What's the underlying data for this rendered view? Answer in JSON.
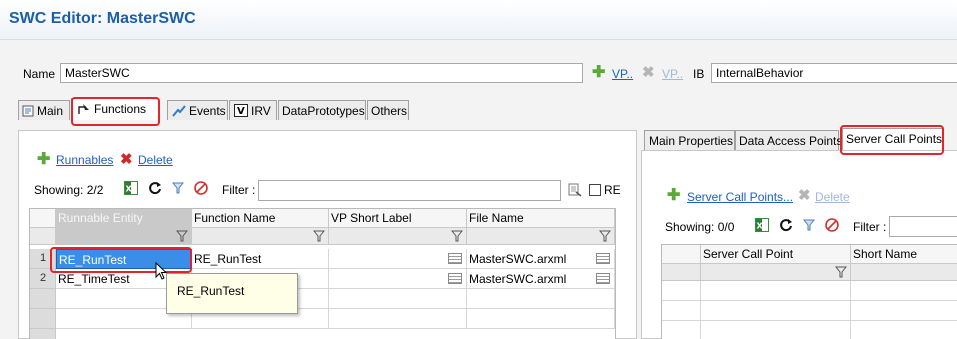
{
  "editor": {
    "title": "SWC Editor: MasterSWC"
  },
  "header": {
    "name_label": "Name",
    "name_value": "MasterSWC",
    "vp_link": "VP..",
    "vp_link_disabled": "VP..",
    "ib_label": "IB",
    "ib_value": "InternalBehavior"
  },
  "tabs": [
    {
      "label": "Main"
    },
    {
      "label": "Functions",
      "active": true
    },
    {
      "label": "Events"
    },
    {
      "label": "IRV"
    },
    {
      "label": "DataPrototypes"
    },
    {
      "label": "Others"
    }
  ],
  "left": {
    "add_link": "Runnables",
    "delete_link": "Delete",
    "showing": "Showing: 2/2",
    "filter_label": "Filter :",
    "filter_value": "",
    "re_label": "RE",
    "columns": [
      "Runnable Entity",
      "Function Name",
      "VP Short Label",
      "File Name"
    ],
    "rows": [
      {
        "num": "1",
        "entity": "RE_RunTest",
        "function": "RE_RunTest",
        "vp": "",
        "file": "MasterSWC.arxml"
      },
      {
        "num": "2",
        "entity": "RE_TimeTest",
        "function": "",
        "vp": "",
        "file": "MasterSWC.arxml"
      }
    ],
    "tooltip": "RE_RunTest"
  },
  "right": {
    "tabs": [
      {
        "label": "Main Properties"
      },
      {
        "label": "Data Access Points"
      },
      {
        "label": "Server Call Points",
        "active": true
      }
    ],
    "add_link": "Server Call Points...",
    "delete_link": "Delete",
    "showing": "Showing: 0/0",
    "filter_label": "Filter :",
    "columns": [
      "Server Call Point",
      "Short Name"
    ]
  },
  "colors": {
    "accent": "#1c5ea8",
    "highlight": "#e3242b",
    "selection": "#3b8ee8"
  }
}
